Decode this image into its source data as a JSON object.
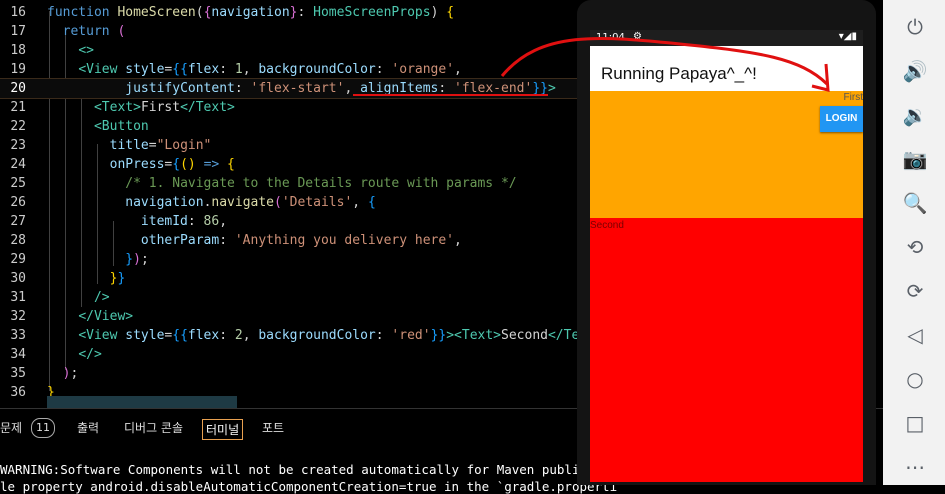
{
  "editor": {
    "lines": [
      {
        "n": "16",
        "parts": [
          [
            "kw",
            "function "
          ],
          [
            "fn",
            "HomeScreen"
          ],
          [
            "pl",
            "("
          ],
          [
            "br2",
            "{"
          ],
          [
            "var",
            "navigation"
          ],
          [
            "br2",
            "}"
          ],
          [
            "pl",
            ": "
          ],
          [
            "ty",
            "HomeScreenProps"
          ],
          [
            "pl",
            ") "
          ],
          [
            "br1",
            "{"
          ]
        ]
      },
      {
        "n": "17",
        "parts": [
          [
            "pl",
            "  "
          ],
          [
            "kw",
            "return "
          ],
          [
            "br2",
            "("
          ]
        ]
      },
      {
        "n": "18",
        "parts": [
          [
            "pl",
            "    "
          ],
          [
            "tag",
            "<>"
          ]
        ]
      },
      {
        "n": "19",
        "parts": [
          [
            "pl",
            "    "
          ],
          [
            "tag",
            "<View "
          ],
          [
            "var",
            "style"
          ],
          [
            "pl",
            "="
          ],
          [
            "br3",
            "{{"
          ],
          [
            "var",
            "flex"
          ],
          [
            "pl",
            ": "
          ],
          [
            "num",
            "1"
          ],
          [
            "pl",
            ", "
          ],
          [
            "var",
            "backgroundColor"
          ],
          [
            "pl",
            ": "
          ],
          [
            "str",
            "'orange'"
          ],
          [
            "pl",
            ","
          ]
        ]
      },
      {
        "n": "20",
        "parts": [
          [
            "pl",
            "          "
          ],
          [
            "var",
            "justifyContent"
          ],
          [
            "pl",
            ": "
          ],
          [
            "str",
            "'flex-start'"
          ],
          [
            "pl",
            ", "
          ],
          [
            "var",
            "alignItems"
          ],
          [
            "pl",
            ": "
          ],
          [
            "str",
            "'flex-end'"
          ],
          [
            "br3",
            "}}"
          ],
          [
            "tag",
            ">"
          ]
        ]
      },
      {
        "n": "21",
        "parts": [
          [
            "pl",
            "      "
          ],
          [
            "tag",
            "<Text>"
          ],
          [
            "pl",
            "First"
          ],
          [
            "tag",
            "</Text>"
          ]
        ]
      },
      {
        "n": "22",
        "parts": [
          [
            "pl",
            "      "
          ],
          [
            "tag",
            "<Button"
          ]
        ]
      },
      {
        "n": "23",
        "parts": [
          [
            "pl",
            "        "
          ],
          [
            "var",
            "title"
          ],
          [
            "pl",
            "="
          ],
          [
            "str",
            "\"Login\""
          ]
        ]
      },
      {
        "n": "24",
        "parts": [
          [
            "pl",
            "        "
          ],
          [
            "var",
            "onPress"
          ],
          [
            "pl",
            "="
          ],
          [
            "br3",
            "{"
          ],
          [
            "br1",
            "() "
          ],
          [
            "kw",
            "=> "
          ],
          [
            "br1",
            "{"
          ]
        ]
      },
      {
        "n": "25",
        "parts": [
          [
            "pl",
            "          "
          ],
          [
            "cmt",
            "/* 1. Navigate to the Details route with params */"
          ]
        ]
      },
      {
        "n": "26",
        "parts": [
          [
            "pl",
            "          "
          ],
          [
            "var",
            "navigation"
          ],
          [
            "pl",
            "."
          ],
          [
            "fn",
            "navigate"
          ],
          [
            "br2",
            "("
          ],
          [
            "str",
            "'Details'"
          ],
          [
            "pl",
            ", "
          ],
          [
            "br3",
            "{"
          ]
        ]
      },
      {
        "n": "27",
        "parts": [
          [
            "pl",
            "            "
          ],
          [
            "var",
            "itemId"
          ],
          [
            "pl",
            ": "
          ],
          [
            "num",
            "86"
          ],
          [
            "pl",
            ","
          ]
        ]
      },
      {
        "n": "28",
        "parts": [
          [
            "pl",
            "            "
          ],
          [
            "var",
            "otherParam"
          ],
          [
            "pl",
            ": "
          ],
          [
            "str",
            "'Anything you delivery here'"
          ],
          [
            "pl",
            ","
          ]
        ]
      },
      {
        "n": "29",
        "parts": [
          [
            "pl",
            "          "
          ],
          [
            "br3",
            "}"
          ],
          [
            "br2",
            ")"
          ],
          [
            "pl",
            ";"
          ]
        ]
      },
      {
        "n": "30",
        "parts": [
          [
            "pl",
            "        "
          ],
          [
            "br1",
            "}"
          ],
          [
            "br3",
            "}"
          ]
        ]
      },
      {
        "n": "31",
        "parts": [
          [
            "pl",
            "      "
          ],
          [
            "tag",
            "/>"
          ]
        ]
      },
      {
        "n": "32",
        "parts": [
          [
            "pl",
            "    "
          ],
          [
            "tag",
            "</View>"
          ]
        ]
      },
      {
        "n": "33",
        "parts": [
          [
            "pl",
            "    "
          ],
          [
            "tag",
            "<View "
          ],
          [
            "var",
            "style"
          ],
          [
            "pl",
            "="
          ],
          [
            "br3",
            "{{"
          ],
          [
            "var",
            "flex"
          ],
          [
            "pl",
            ": "
          ],
          [
            "num",
            "2"
          ],
          [
            "pl",
            ", "
          ],
          [
            "var",
            "backgroundColor"
          ],
          [
            "pl",
            ": "
          ],
          [
            "str",
            "'red'"
          ],
          [
            "br3",
            "}}"
          ],
          [
            "tag",
            "><Text>"
          ],
          [
            "pl",
            "Second"
          ],
          [
            "tag",
            "</Tex"
          ]
        ]
      },
      {
        "n": "34",
        "parts": [
          [
            "pl",
            "    "
          ],
          [
            "tag",
            "</>"
          ]
        ]
      },
      {
        "n": "35",
        "parts": [
          [
            "pl",
            "  "
          ],
          [
            "br2",
            ")"
          ],
          [
            "pl",
            ";"
          ]
        ]
      },
      {
        "n": "36",
        "parts": [
          [
            "br1",
            "}"
          ]
        ]
      }
    ]
  },
  "panel": {
    "tab_problems": "문제",
    "problems_count": "11",
    "tab_output": "출력",
    "tab_debug_console": "디버그 콘솔",
    "tab_terminal": "터미널",
    "tab_ports": "포트",
    "terminal_line1": "WARNING:Software Components will not be created automatically for Maven publishing",
    "terminal_line2": "le property android.disableAutomaticComponentCreation=true in the `gradle.properti"
  },
  "emulator": {
    "time": "11:04",
    "app_title": "Running Papaya^_^!",
    "first_text": "First",
    "login_label": "LOGIN",
    "second_text": "Second",
    "orange_color": "#ffa500",
    "red_color": "#ff0000"
  },
  "emulator_controls": [
    "power-icon",
    "volume-up-icon",
    "volume-down-icon",
    "camera-icon",
    "zoom-icon",
    "rotate-left-icon",
    "rotate-right-icon",
    "back-icon",
    "home-icon",
    "overview-icon",
    "more-icon"
  ]
}
